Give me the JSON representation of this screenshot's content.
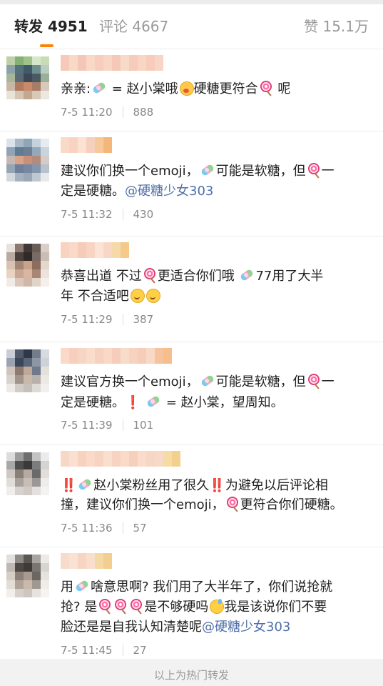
{
  "tabs": {
    "repost_label": "转发",
    "repost_count": "4951",
    "comment_label": "评论",
    "comment_count": "4667",
    "like_label": "赞",
    "like_count": "15.1万"
  },
  "items": [
    {
      "username_colors": [
        "#f6c9b8",
        "#f8d9c8",
        "#f5c6b8",
        "#fad8c8",
        "#f7cdbf",
        "#f9d6c4",
        "#f6c8b8",
        "#f8dac9",
        "#f6cbbb",
        "#f9d5c3",
        "#f7ccbb",
        "#f8d6c7"
      ],
      "avatar_colors": [
        "#bcd1a7",
        "#86b074",
        "#a0c38a",
        "#d5e6c9",
        "#c7dbb5",
        "#8aa2a8",
        "#54707a",
        "#3f5a68",
        "#6f8f8f",
        "#b8ccc0",
        "#a5b69b",
        "#5a6a74",
        "#3c4854",
        "#4a5a64",
        "#9aae98",
        "#c9b7a5",
        "#b07a60",
        "#c98a6a",
        "#a87c66",
        "#d8c9bb",
        "#e9e3d6",
        "#d6c4b4",
        "#c2a890",
        "#d9c8b6",
        "#ede8df"
      ],
      "lines": [
        [
          {
            "t": "text",
            "v": "亲亲:"
          },
          {
            "t": "emoji",
            "v": "candy"
          },
          {
            "t": "text",
            "v": " = 赵小棠哦"
          },
          {
            "t": "emoji",
            "v": "shy"
          },
          {
            "t": "text",
            "v": "硬糖更符合"
          },
          {
            "t": "emoji",
            "v": "lolly"
          },
          {
            "t": "text",
            "v": " 呢"
          }
        ]
      ],
      "time": "7-5 11:20",
      "count": "888"
    },
    {
      "username_colors": [
        "#f9dac8",
        "#f8d3c1",
        "#fbe2d2",
        "#f7cfbd",
        "#f7c99a",
        "#f3b878"
      ],
      "avatar_colors": [
        "#dbe3ea",
        "#a9b8c6",
        "#8fa6b8",
        "#c4d2dc",
        "#e5ebef",
        "#8fa4b6",
        "#5f7c95",
        "#6d7f94",
        "#93a9bb",
        "#c9d4dd",
        "#c7b7b0",
        "#d8a38b",
        "#c88f79",
        "#b58a7c",
        "#d5ccc7",
        "#93a6b4",
        "#6f7f99",
        "#7787a0",
        "#8496ad",
        "#b6c2cc",
        "#d3d8de",
        "#a5b2bf",
        "#9aa7b5",
        "#bfc8d1",
        "#e6e9ec"
      ],
      "lines": [
        [
          {
            "t": "text",
            "v": "建议你们换一个emoji，"
          },
          {
            "t": "emoji",
            "v": "candy"
          },
          {
            "t": "text",
            "v": "可能是软糖，但"
          },
          {
            "t": "emoji",
            "v": "lolly"
          },
          {
            "t": "text",
            "v": "一"
          }
        ],
        [
          {
            "t": "text",
            "v": "定是硬糖。"
          },
          {
            "t": "mention",
            "v": "@硬糖少女303"
          }
        ]
      ],
      "time": "7-5 11:32",
      "count": "430"
    },
    {
      "username_colors": [
        "#f7d3c0",
        "#f9dac8",
        "#f6cbb7",
        "#f8d4c2",
        "#fbe3d5",
        "#f8d7c5",
        "#f5d9a8",
        "#f4c98a"
      ],
      "avatar_colors": [
        "#e8e2dc",
        "#8a7a72",
        "#3f3836",
        "#6a5d58",
        "#d9cfc8",
        "#b9aaa2",
        "#4a3f3b",
        "#2f2927",
        "#786a64",
        "#cbbdb4",
        "#d9c2b2",
        "#a38776",
        "#c9a28c",
        "#8c6d5e",
        "#e4d7cd",
        "#e8d3c3",
        "#c9a691",
        "#d8b6a2",
        "#a98573",
        "#ede3dc",
        "#f1ebe6",
        "#dac7ba",
        "#cfb8a8",
        "#e2d3c8",
        "#f4efeb"
      ],
      "lines": [
        [
          {
            "t": "text",
            "v": "恭喜出道  不过"
          },
          {
            "t": "emoji",
            "v": "lolly"
          },
          {
            "t": "text",
            "v": "更适合你们哦 "
          },
          {
            "t": "emoji",
            "v": "candy"
          },
          {
            "t": "text",
            "v": "77用了大半"
          }
        ],
        [
          {
            "t": "text",
            "v": "年 不合适吧"
          },
          {
            "t": "emoji",
            "v": "smile"
          },
          {
            "t": "emoji",
            "v": "smile"
          }
        ]
      ],
      "time": "7-5 11:29",
      "count": "387"
    },
    {
      "username_colors": [
        "#fad9c9",
        "#f8cfbd",
        "#f7d5c4",
        "#f9dccb",
        "#f7d1bf",
        "#f8d8c6",
        "#f6cdbb",
        "#f9dbc9",
        "#f7d2c0",
        "#f6cdb9",
        "#f8d9c7",
        "#f6c39c",
        "#f4bf8c"
      ],
      "avatar_colors": [
        "#c9ced6",
        "#4f5a6c",
        "#2f3848",
        "#727d8c",
        "#d7dbe0",
        "#9aa3b0",
        "#3c4658",
        "#5a667a",
        "#8c96a5",
        "#cdd2d8",
        "#cfc4bc",
        "#8c7a70",
        "#bfa89a",
        "#6e7a8c",
        "#e4e0dc",
        "#d8d2cd",
        "#a2948a",
        "#c9b9ad",
        "#b8b0aa",
        "#ece8e4",
        "#ece9e6",
        "#d1ccc8",
        "#c6c0bb",
        "#dedad6",
        "#f2f0ee"
      ],
      "lines": [
        [
          {
            "t": "text",
            "v": "建议官方换一个emoji，"
          },
          {
            "t": "emoji",
            "v": "candy"
          },
          {
            "t": "text",
            "v": "可能是软糖，但"
          },
          {
            "t": "emoji",
            "v": "lolly"
          },
          {
            "t": "text",
            "v": "一"
          }
        ],
        [
          {
            "t": "text",
            "v": "定是硬糖。"
          },
          {
            "t": "bang",
            "v": "❗"
          },
          {
            "t": "text",
            "v": " "
          },
          {
            "t": "emoji",
            "v": "candy"
          },
          {
            "t": "text",
            "v": " = 赵小棠，望周知。"
          }
        ]
      ],
      "time": "7-5 11:39",
      "count": "101"
    },
    {
      "username_colors": [
        "#f7d7c5",
        "#f9e0d0",
        "#f8d2bf",
        "#fad9c8",
        "#f7d4c1",
        "#f9dfcf",
        "#f8d3c1",
        "#fadbc9",
        "#f6cfbd",
        "#f9dccb",
        "#f7d6c4",
        "#f8d8c7",
        "#f5dca4",
        "#f3d08e"
      ],
      "avatar_colors": [
        "#dcdcdc",
        "#9c9c9c",
        "#6e6e6e",
        "#c2c2c2",
        "#ebebeb",
        "#a8a8a8",
        "#4e4e4e",
        "#3a3a3a",
        "#7c7c7c",
        "#d4d4d4",
        "#cfc8c2",
        "#8a8078",
        "#b8aaa0",
        "#6a6a6a",
        "#e2dedb",
        "#e0dcd8",
        "#a8a09a",
        "#c6bdb6",
        "#9c9898",
        "#efedeb",
        "#f0eeec",
        "#d6d2cf",
        "#cfcac6",
        "#e3e0dd",
        "#f5f3f2"
      ],
      "lines": [
        [
          {
            "t": "bang",
            "v": "‼️"
          },
          {
            "t": "emoji",
            "v": "candy"
          },
          {
            "t": "text",
            "v": "赵小棠粉丝用了很久"
          },
          {
            "t": "bang",
            "v": "‼️"
          },
          {
            "t": "text",
            "v": "为避免以后评论相"
          }
        ],
        [
          {
            "t": "text",
            "v": "撞，建议你们换一个emoji，"
          },
          {
            "t": "emoji",
            "v": "lolly"
          },
          {
            "t": "text",
            "v": "更符合你们硬糖。"
          }
        ]
      ],
      "time": "7-5 11:36",
      "count": "57"
    },
    {
      "username_colors": [
        "#f7dcc9",
        "#f9e2d3",
        "#f8d5c3",
        "#fadecd",
        "#f4d8a6",
        "#f2cf90"
      ],
      "avatar_colors": [
        "#e2dfdc",
        "#8f8a86",
        "#5a5652",
        "#a9a49f",
        "#ece9e6",
        "#bdb8b3",
        "#4c4844",
        "#3e3a37",
        "#7a7571",
        "#d8d4d0",
        "#d6cdc5",
        "#8c8078",
        "#a89a8e",
        "#6c6660",
        "#e6e2de",
        "#e4ddd6",
        "#b0a398",
        "#c9b9aa",
        "#9f9791",
        "#f0ece8",
        "#f1eeeb",
        "#d6d0cb",
        "#cdc6c0",
        "#e6e2de",
        "#f6f4f2"
      ],
      "lines": [
        [
          {
            "t": "text",
            "v": "用"
          },
          {
            "t": "emoji",
            "v": "candy"
          },
          {
            "t": "text",
            "v": "啥意思啊? 我们用了大半年了，你们说抢就"
          }
        ],
        [
          {
            "t": "text",
            "v": "抢? 是"
          },
          {
            "t": "emoji",
            "v": "lolly"
          },
          {
            "t": "emoji",
            "v": "lolly"
          },
          {
            "t": "emoji",
            "v": "lolly"
          },
          {
            "t": "text",
            "v": "是不够硬吗"
          },
          {
            "t": "emoji",
            "v": "sweat"
          },
          {
            "t": "text",
            "v": "我是该说你们不要"
          }
        ],
        [
          {
            "t": "text",
            "v": "脸还是是自我认知清楚呢"
          },
          {
            "t": "mention",
            "v": "@硬糖少女303"
          }
        ]
      ],
      "time": "7-5 11:45",
      "count": "27"
    }
  ],
  "footer_text": "以上为热门转发",
  "colors": {
    "accent": "#ff8200",
    "mention": "#4f6fa8",
    "meta_text": "#888888"
  }
}
